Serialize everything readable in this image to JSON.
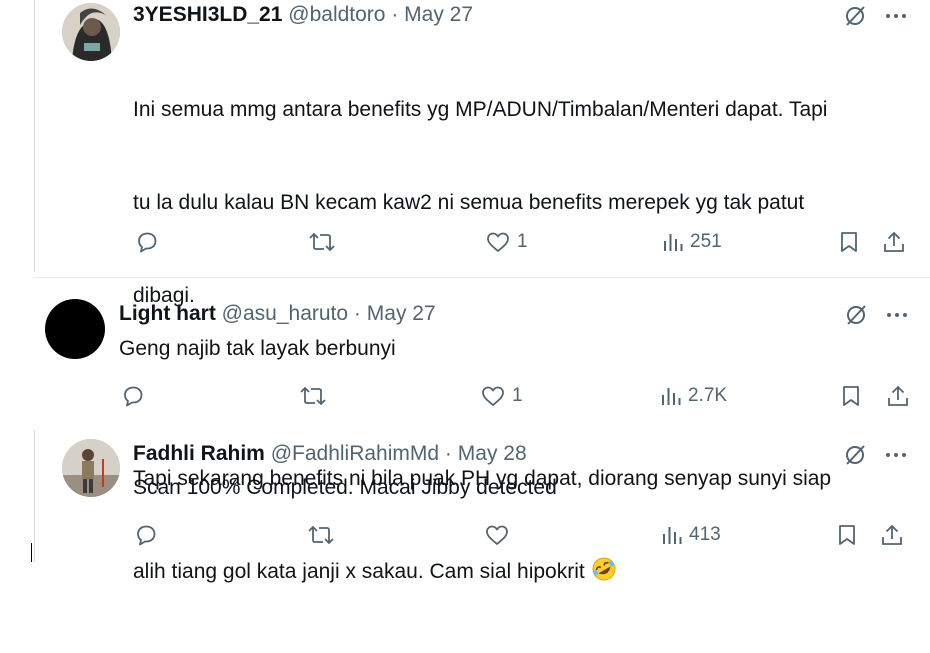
{
  "tweets": [
    {
      "name": "3YESHI3LD_21",
      "handle": "@baldtoro",
      "separator": "·",
      "date": "May 27",
      "text_line1": "Ini semua mmg antara benefits yg MP/ADUN/Timbalan/Menteri dapat. Tapi",
      "text_line2": "tu la dulu kalau BN kecam kaw2 ni semua benefits merepek yg tak patut",
      "text_line3": "dibagi.",
      "text_line4": "Tapi sekarang benefits ni bila puak PH yg dapat, diorang senyap sunyi siap",
      "text_line5": "alih tiang gol kata janji x sakau. Cam sial hipokrit",
      "emoji": "rolling-on-floor-laughing",
      "likes": "1",
      "views": "251"
    },
    {
      "name": "Light hart",
      "handle": "@asu_haruto",
      "separator": "·",
      "date": "May 27",
      "text": "Geng najib tak layak berbunyi",
      "likes": "1",
      "views": "2.7K"
    },
    {
      "name": "Fadhli Rahim",
      "handle": "@FadhliRahimMd",
      "separator": "·",
      "date": "May 28",
      "text": "Scan 100% Completed. Macai Jibby detected",
      "likes": "",
      "views": "413"
    }
  ],
  "icons": [
    "grok-icon",
    "more-icon",
    "reply-icon",
    "retweet-icon",
    "like-icon",
    "views-icon",
    "bookmark-icon",
    "share-icon"
  ],
  "colors": {
    "text": "#0f1419",
    "muted": "#536471",
    "divider": "#e6e9ec"
  }
}
